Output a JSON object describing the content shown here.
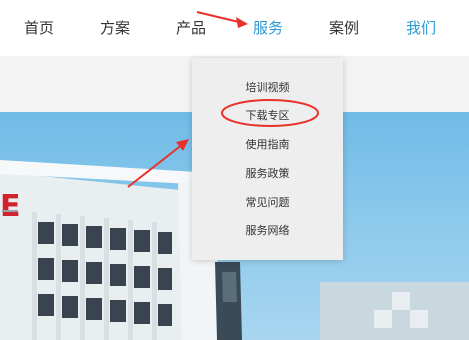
{
  "nav": {
    "items": [
      {
        "label": "首页"
      },
      {
        "label": "方案"
      },
      {
        "label": "产品"
      },
      {
        "label": "服务",
        "active": true
      },
      {
        "label": "案例"
      },
      {
        "label": "我们"
      }
    ]
  },
  "dropdown": {
    "items": [
      {
        "label": "培训视频"
      },
      {
        "label": "下载专区",
        "highlighted": true
      },
      {
        "label": "使用指南"
      },
      {
        "label": "服务政策"
      },
      {
        "label": "常见问题"
      },
      {
        "label": "服务网络"
      }
    ]
  },
  "hero": {
    "logo_text": "E"
  },
  "annotations": {
    "color": "#e8312a",
    "arrow-icon": "red-arrow",
    "ellipse-icon": "red-ellipse"
  },
  "colors": {
    "accent": "#2d9bd6",
    "text": "#333333"
  }
}
